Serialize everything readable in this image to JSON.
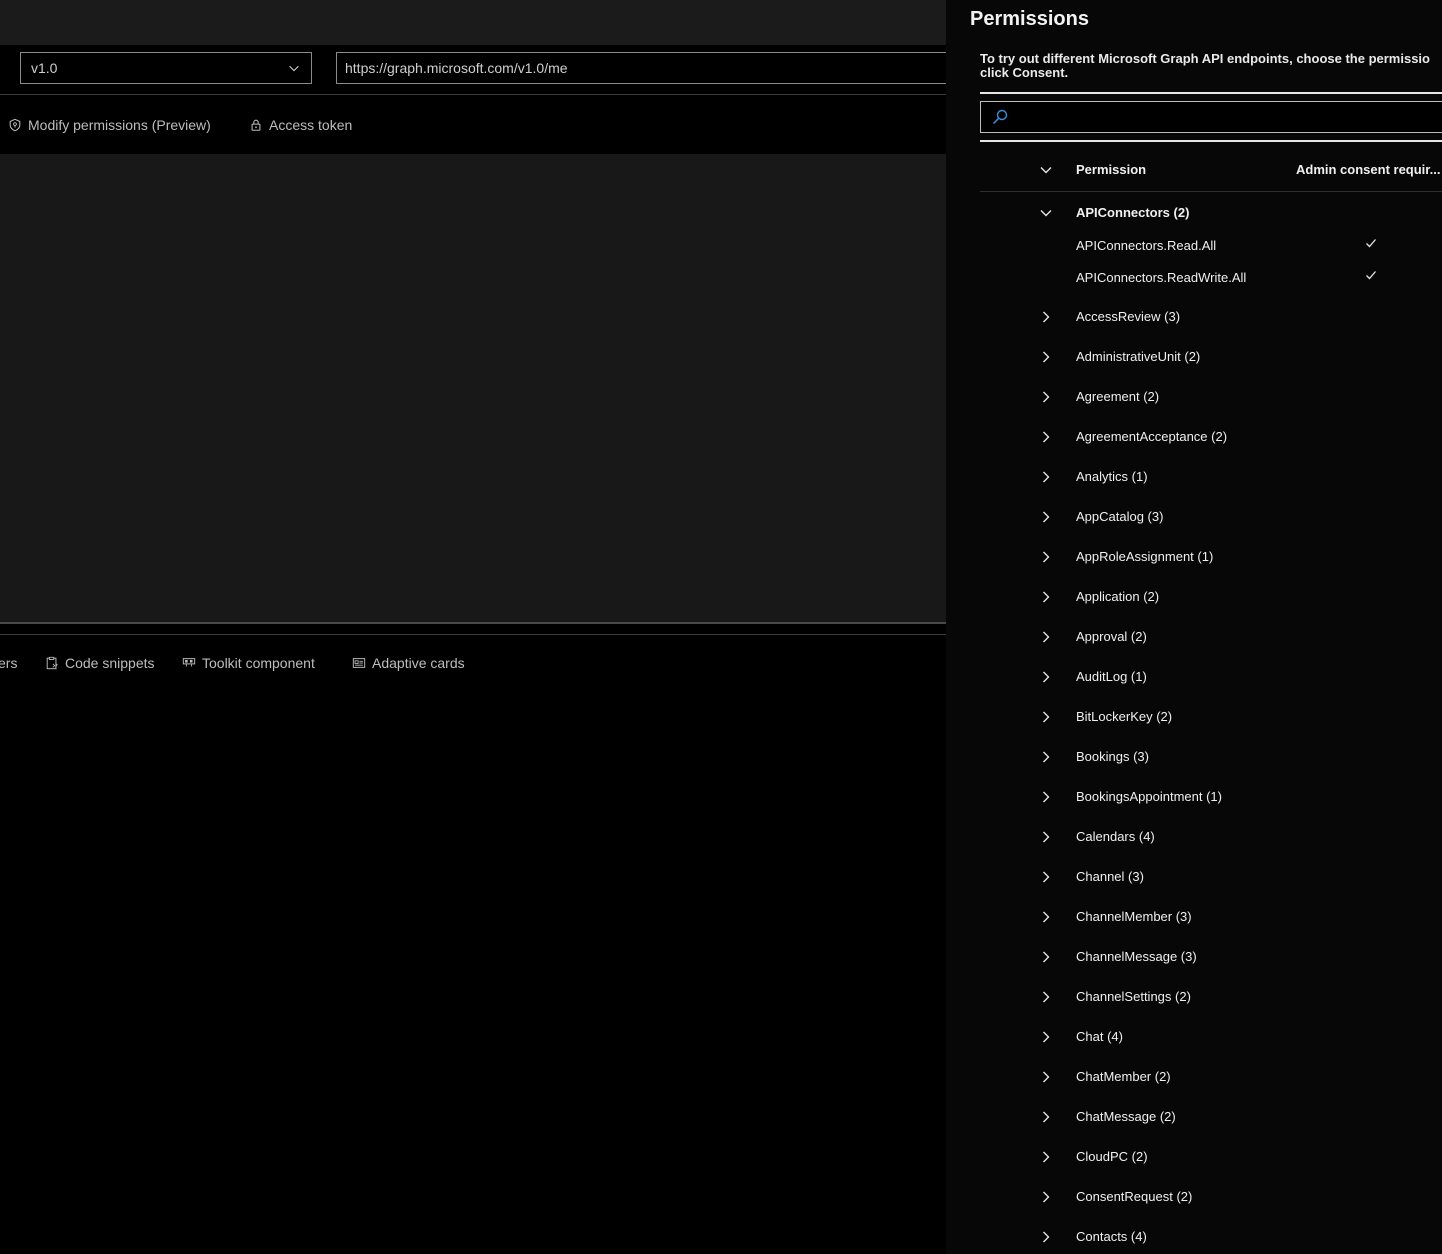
{
  "explorer": {
    "version": "v1.0",
    "url": "https://graph.microsoft.com/v1.0/me",
    "request_tabs": [
      {
        "label": "Modify permissions (Preview)",
        "icon": "shield-icon"
      },
      {
        "label": "Access token",
        "icon": "lock-icon"
      }
    ],
    "response_tabs": [
      {
        "label": "ers",
        "icon": "none"
      },
      {
        "label": "Code snippets",
        "icon": "clipboard-code-icon"
      },
      {
        "label": "Toolkit component",
        "icon": "toolkit-icon"
      },
      {
        "label": "Adaptive cards",
        "icon": "card-icon"
      }
    ]
  },
  "panel": {
    "title": "Permissions",
    "description_line1": "To try out different Microsoft Graph API endpoints, choose the permissio",
    "description_line2": "click Consent.",
    "search": {
      "placeholder": "",
      "value": "",
      "icon": "search-icon"
    },
    "columns": {
      "permission": "Permission",
      "admin_consent": "Admin consent requir..."
    },
    "expanded_group": {
      "label": "APIConnectors (2)",
      "children": [
        {
          "label": "APIConnectors.Read.All",
          "admin_consent_required": true
        },
        {
          "label": "APIConnectors.ReadWrite.All",
          "admin_consent_required": true
        }
      ]
    },
    "collapsed_groups": [
      "AccessReview (3)",
      "AdministrativeUnit (2)",
      "Agreement (2)",
      "AgreementAcceptance (2)",
      "Analytics (1)",
      "AppCatalog (3)",
      "AppRoleAssignment (1)",
      "Application (2)",
      "Approval (2)",
      "AuditLog (1)",
      "BitLockerKey (2)",
      "Bookings (3)",
      "BookingsAppointment (1)",
      "Calendars (4)",
      "Channel (3)",
      "ChannelMember (3)",
      "ChannelMessage (3)",
      "ChannelSettings (2)",
      "Chat (4)",
      "ChatMember (2)",
      "ChatMessage (2)",
      "CloudPC (2)",
      "ConsentRequest (2)",
      "Contacts (4)"
    ]
  }
}
